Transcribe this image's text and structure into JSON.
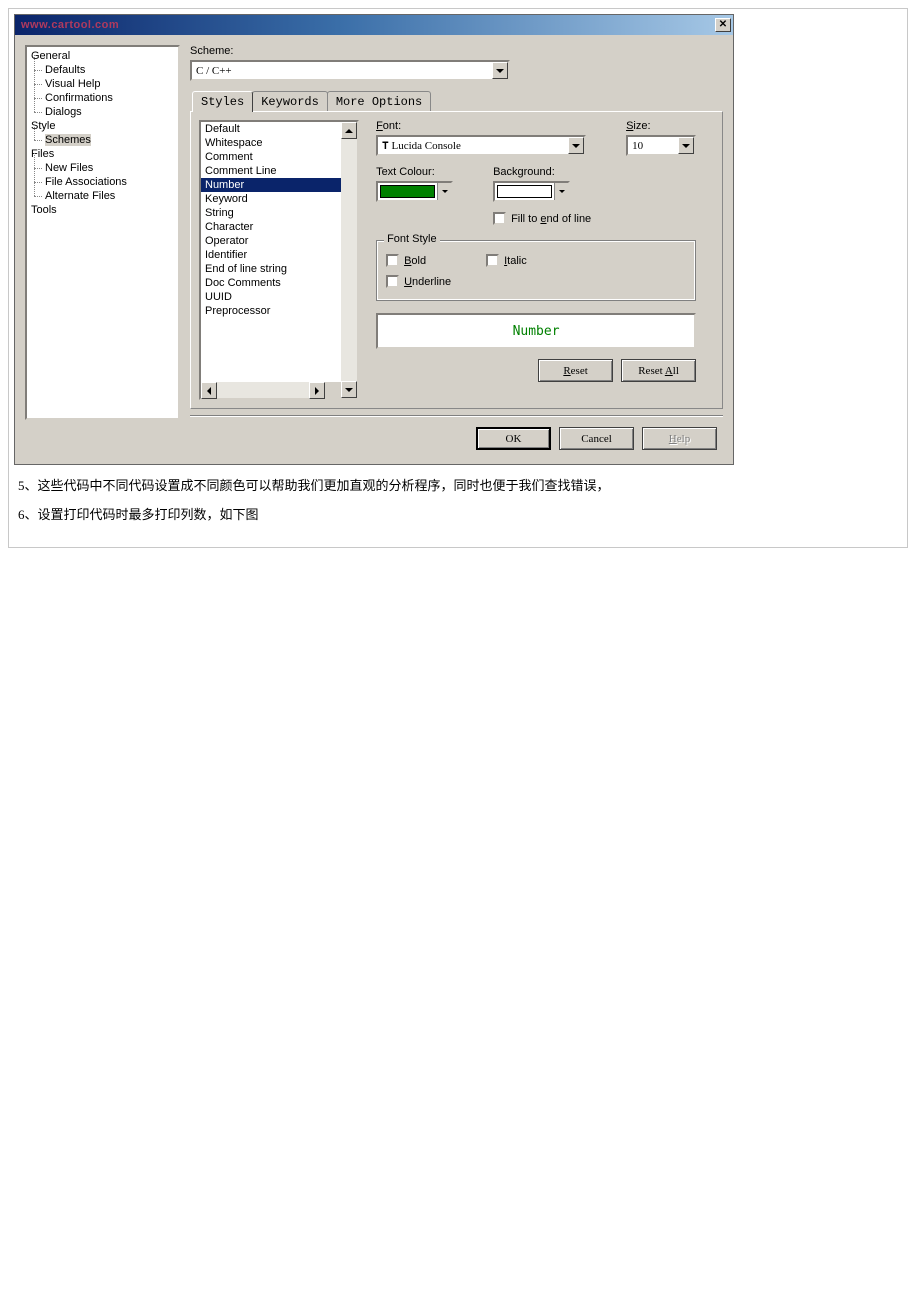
{
  "titlebar": {
    "watermark": "www.cartool.com"
  },
  "tree": {
    "items": [
      {
        "label": "General",
        "level": 0
      },
      {
        "label": "Defaults",
        "level": 1
      },
      {
        "label": "Visual Help",
        "level": 1
      },
      {
        "label": "Confirmations",
        "level": 1
      },
      {
        "label": "Dialogs",
        "level": 1
      },
      {
        "label": "Style",
        "level": 0
      },
      {
        "label": "Schemes",
        "level": 1,
        "selected": true
      },
      {
        "label": "Files",
        "level": 0
      },
      {
        "label": "New Files",
        "level": 1
      },
      {
        "label": "File Associations",
        "level": 1
      },
      {
        "label": "Alternate Files",
        "level": 1
      },
      {
        "label": "Tools",
        "level": 0
      }
    ]
  },
  "scheme": {
    "label": "Scheme:",
    "value": "C / C++"
  },
  "tabs": {
    "items": [
      "Styles",
      "Keywords",
      "More Options"
    ],
    "active": 0
  },
  "styles_list": {
    "items": [
      "Default",
      "Whitespace",
      "Comment",
      "Comment Line",
      "Number",
      "Keyword",
      "String",
      "Character",
      "Operator",
      "Identifier",
      "End of line string",
      "Doc Comments",
      "UUID",
      "Preprocessor"
    ],
    "selected": "Number"
  },
  "font": {
    "label": "Font:",
    "value": "Lucida Console",
    "size_label": "Size:",
    "size_value": "10"
  },
  "colors": {
    "text_label": "Text Colour:",
    "text_value": "#008000",
    "bg_label": "Background:",
    "bg_value": "#ffffff",
    "fill_eol_label": "Fill to end of line"
  },
  "font_style": {
    "legend": "Font Style",
    "bold": "Bold",
    "italic": "Italic",
    "underline": "Underline"
  },
  "preview": {
    "text": "Number"
  },
  "pane_buttons": {
    "reset": "Reset",
    "reset_all": "Reset All"
  },
  "dialog_buttons": {
    "ok": "OK",
    "cancel": "Cancel",
    "help": "Help"
  },
  "captions": {
    "line5": "5、这些代码中不同代码设置成不同颜色可以帮助我们更加直观的分析程序，同时也便于我们查找错误，",
    "line6": "6、设置打印代码时最多打印列数，如下图"
  }
}
